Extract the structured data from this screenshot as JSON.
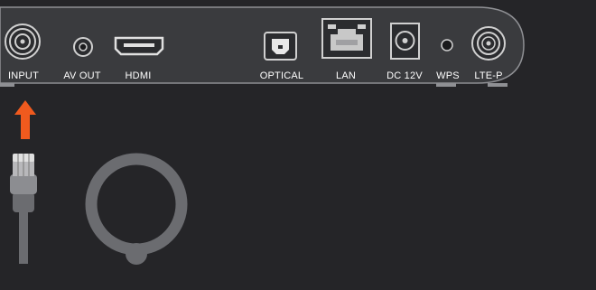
{
  "panel": {
    "colors": {
      "background": "#252528",
      "panel": "#3a3b3e",
      "panel_border": "#8f9094",
      "label_text": "#ffffff",
      "arrow": "#f05a1e",
      "cable": "#6b6c70",
      "connector": "#d0d0d0"
    },
    "ports": [
      {
        "id": "input",
        "label": "INPUT",
        "icon": "coax-f-connector-icon"
      },
      {
        "id": "av-out",
        "label": "AV OUT",
        "icon": "av-jack-icon"
      },
      {
        "id": "hdmi",
        "label": "HDMI",
        "icon": "hdmi-port-icon"
      },
      {
        "id": "optical",
        "label": "OPTICAL",
        "icon": "optical-port-icon"
      },
      {
        "id": "lan",
        "label": "LAN",
        "icon": "ethernet-port-icon"
      },
      {
        "id": "dc-12v",
        "label": "DC 12V",
        "icon": "dc-power-jack-icon"
      },
      {
        "id": "wps",
        "label": "WPS",
        "icon": "wps-button-icon"
      },
      {
        "id": "lte-p",
        "label": "LTE-P",
        "icon": "sma-antenna-connector-icon"
      }
    ]
  },
  "illustration": {
    "arrow_icon": "up-arrow-icon",
    "cable_icon": "coax-cable-connector-icon",
    "loop_icon": "cable-loop-icon"
  }
}
